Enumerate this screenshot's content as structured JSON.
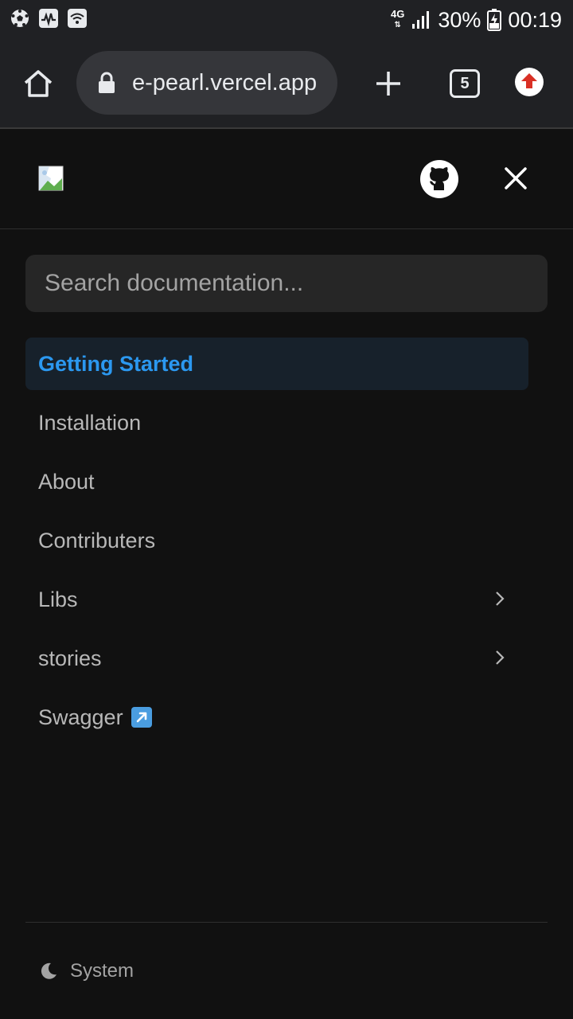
{
  "status_bar": {
    "icons": [
      "soccer-ball-icon",
      "activity-icon",
      "wifi-icon"
    ],
    "network": "4G",
    "battery": "30%",
    "time": "00:19"
  },
  "browser": {
    "url": "e-pearl.vercel.app",
    "tab_count": "5",
    "icons": [
      "home-icon",
      "lock-icon",
      "plus-icon",
      "tabs-icon",
      "update-icon"
    ],
    "update_color": "#d93025"
  },
  "header": {
    "icons": [
      "broken-image-icon",
      "github-icon",
      "close-icon"
    ]
  },
  "search": {
    "placeholder": "Search documentation..."
  },
  "nav": {
    "items": [
      {
        "label": "Getting Started",
        "active": true
      },
      {
        "label": "Installation"
      },
      {
        "label": "About"
      },
      {
        "label": "Contributers"
      },
      {
        "label": "Libs",
        "expandable": true
      },
      {
        "label": "stories",
        "expandable": true
      },
      {
        "label": "Swagger",
        "external": true
      }
    ],
    "active_color": "#2b98f0"
  },
  "footer": {
    "theme_label": "System",
    "icon": "moon-icon"
  }
}
